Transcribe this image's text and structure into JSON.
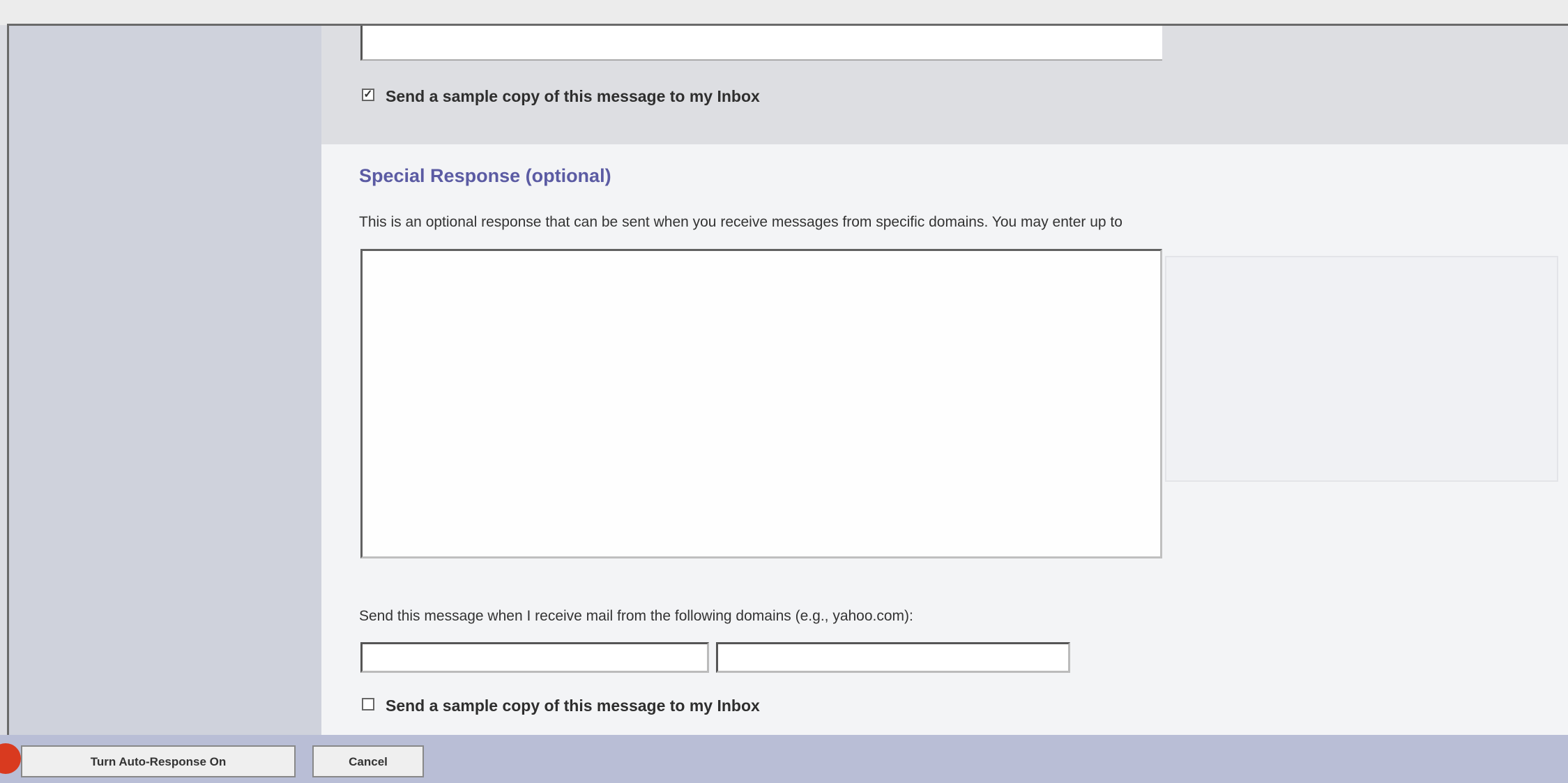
{
  "top_sample_copy": {
    "checked": true,
    "label": "Send a sample copy of this message to my Inbox"
  },
  "special_response": {
    "title": "Special Response (optional)",
    "description": "This is an optional response that can be sent when you receive messages from specific domains. You may enter up to",
    "message_value": "",
    "domains_label": "Send this message when I receive mail from the following domains (e.g., yahoo.com):",
    "domain_1": "",
    "domain_2": ""
  },
  "bottom_sample_copy": {
    "checked": false,
    "label": "Send a sample copy of this message to my Inbox"
  },
  "buttons": {
    "turn_on": "Turn Auto-Response On",
    "cancel": "Cancel"
  },
  "colors": {
    "section_title": "#5b5ba3",
    "bottom_bar": "#b9bed6",
    "alert_dot": "#d93a1f"
  }
}
